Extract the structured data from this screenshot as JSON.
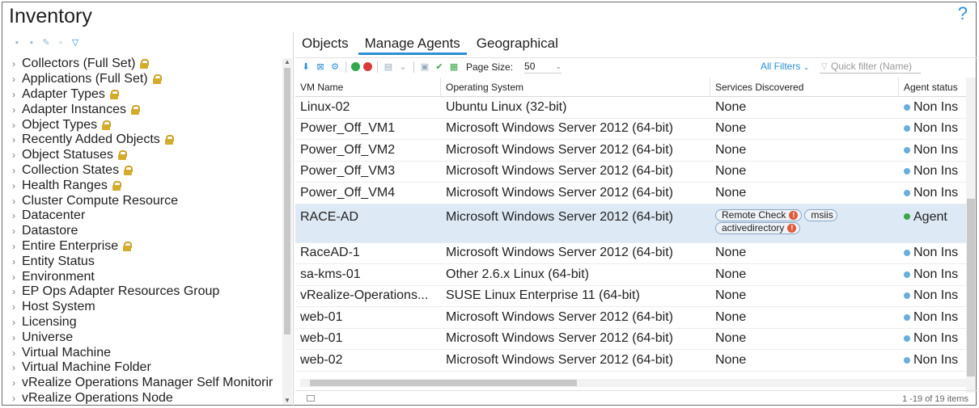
{
  "header": {
    "title": "Inventory",
    "help": "?"
  },
  "tree": {
    "items": [
      {
        "label": "Collectors (Full Set)",
        "locked": true
      },
      {
        "label": "Applications (Full Set)",
        "locked": true
      },
      {
        "label": "Adapter Types",
        "locked": true
      },
      {
        "label": "Adapter Instances",
        "locked": true
      },
      {
        "label": "Object Types",
        "locked": true
      },
      {
        "label": "Recently Added Objects",
        "locked": true
      },
      {
        "label": "Object Statuses",
        "locked": true
      },
      {
        "label": "Collection States",
        "locked": true
      },
      {
        "label": "Health Ranges",
        "locked": true
      },
      {
        "label": "Cluster Compute Resource",
        "locked": false
      },
      {
        "label": "Datacenter",
        "locked": false
      },
      {
        "label": "Datastore",
        "locked": false
      },
      {
        "label": "Entire Enterprise",
        "locked": true
      },
      {
        "label": "Entity Status",
        "locked": false
      },
      {
        "label": "Environment",
        "locked": false
      },
      {
        "label": "EP Ops Adapter Resources Group",
        "locked": false
      },
      {
        "label": "Host System",
        "locked": false
      },
      {
        "label": "Licensing",
        "locked": false
      },
      {
        "label": "Universe",
        "locked": false
      },
      {
        "label": "Virtual Machine",
        "locked": false
      },
      {
        "label": "Virtual Machine Folder",
        "locked": false
      },
      {
        "label": "vRealize Operations Manager Self Monitorir",
        "locked": false
      },
      {
        "label": "vRealize Operations Node",
        "locked": false
      }
    ]
  },
  "tabs": [
    {
      "label": "Objects",
      "active": false
    },
    {
      "label": "Manage Agents",
      "active": true
    },
    {
      "label": "Geographical",
      "active": false
    }
  ],
  "toolbar": {
    "page_size_label": "Page Size:",
    "page_size_value": "50",
    "all_filters": "All Filters",
    "quick_filter_placeholder": "Quick filter (Name)"
  },
  "grid": {
    "columns": [
      "VM Name",
      "Operating System",
      "Services Discovered",
      "Agent status"
    ],
    "rows": [
      {
        "name": "Linux-02",
        "os": "Ubuntu Linux (32-bit)",
        "services": "None",
        "status": "Non Ins",
        "status_color": "blue"
      },
      {
        "name": "Power_Off_VM1",
        "os": "Microsoft Windows Server 2012 (64-bit)",
        "services": "None",
        "status": "Non Ins",
        "status_color": "blue"
      },
      {
        "name": "Power_Off_VM2",
        "os": "Microsoft Windows Server 2012 (64-bit)",
        "services": "None",
        "status": "Non Ins",
        "status_color": "blue"
      },
      {
        "name": "Power_Off_VM3",
        "os": "Microsoft Windows Server 2012 (64-bit)",
        "services": "None",
        "status": "Non Ins",
        "status_color": "blue"
      },
      {
        "name": "Power_Off_VM4",
        "os": "Microsoft Windows Server 2012 (64-bit)",
        "services": "None",
        "status": "Non Ins",
        "status_color": "blue"
      },
      {
        "name": "RACE-AD",
        "os": "Microsoft Windows Server 2012 (64-bit)",
        "services": "",
        "pills": [
          {
            "label": "Remote Check",
            "warn": true
          },
          {
            "label": "msiis",
            "warn": false
          },
          {
            "label": "activedirectory",
            "warn": true
          }
        ],
        "status": "Agent",
        "status_color": "green",
        "selected": true
      },
      {
        "name": "RaceAD-1",
        "os": "Microsoft Windows Server 2012 (64-bit)",
        "services": "None",
        "status": "Non Ins",
        "status_color": "blue"
      },
      {
        "name": "sa-kms-01",
        "os": "Other 2.6.x Linux (64-bit)",
        "services": "None",
        "status": "Non Ins",
        "status_color": "blue"
      },
      {
        "name": "vRealize-Operations...",
        "os": "SUSE Linux Enterprise 11 (64-bit)",
        "services": "None",
        "status": "Non Ins",
        "status_color": "blue"
      },
      {
        "name": "web-01",
        "os": "Microsoft Windows Server 2012 (64-bit)",
        "services": "None",
        "status": "Non Ins",
        "status_color": "blue"
      },
      {
        "name": "web-01",
        "os": "Microsoft Windows Server 2012 (64-bit)",
        "services": "None",
        "status": "Non Ins",
        "status_color": "blue"
      },
      {
        "name": "web-02",
        "os": "Microsoft Windows Server 2012 (64-bit)",
        "services": "None",
        "status": "Non Ins",
        "status_color": "blue"
      }
    ]
  },
  "footer": {
    "count": "1 -19 of 19 items"
  },
  "colors": {
    "accent": "#2b8fd6",
    "selected_row": "#dde9f4",
    "lock": "#d4ac2b",
    "status_blue": "#6aaedb",
    "status_green": "#3aa64a",
    "warn": "#e25a3a"
  },
  "icons": {
    "warn_glyph": "!"
  }
}
